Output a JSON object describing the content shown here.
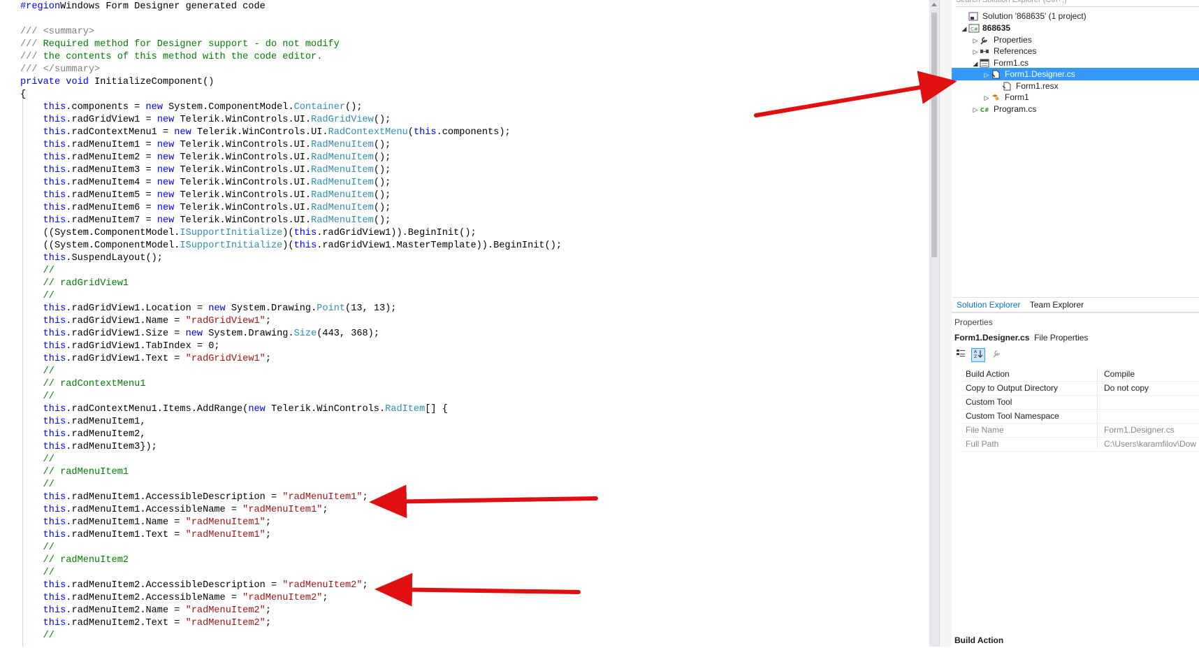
{
  "code_lines": [
    [
      [
        "kw",
        "#region"
      ],
      [
        "",
        "Windows Form Designer generated code"
      ]
    ],
    [],
    [
      [
        "doc",
        "/// <summary>"
      ]
    ],
    [
      [
        "doc",
        "/// "
      ],
      [
        "cm",
        "Required method for Designer support - do not modify"
      ]
    ],
    [
      [
        "doc",
        "/// "
      ],
      [
        "cm",
        "the contents of this method with the code editor."
      ]
    ],
    [
      [
        "doc",
        "/// </summary>"
      ]
    ],
    [
      [
        "kw",
        "private"
      ],
      [
        "",
        " "
      ],
      [
        "kw",
        "void"
      ],
      [
        "",
        " InitializeComponent()"
      ]
    ],
    [
      [
        "",
        "{"
      ]
    ],
    [
      [
        "",
        "    "
      ],
      [
        "kw",
        "this"
      ],
      [
        "",
        ".components = "
      ],
      [
        "kw",
        "new"
      ],
      [
        "",
        " System.ComponentModel."
      ],
      [
        "ty",
        "Container"
      ],
      [
        "",
        "();"
      ]
    ],
    [
      [
        "",
        "    "
      ],
      [
        "kw",
        "this"
      ],
      [
        "",
        ".radGridView1 = "
      ],
      [
        "kw",
        "new"
      ],
      [
        "",
        " Telerik.WinControls.UI."
      ],
      [
        "ty",
        "RadGridView"
      ],
      [
        "",
        "();"
      ]
    ],
    [
      [
        "",
        "    "
      ],
      [
        "kw",
        "this"
      ],
      [
        "",
        ".radContextMenu1 = "
      ],
      [
        "kw",
        "new"
      ],
      [
        "",
        " Telerik.WinControls.UI."
      ],
      [
        "ty",
        "RadContextMenu"
      ],
      [
        "",
        "("
      ],
      [
        "kw",
        "this"
      ],
      [
        "",
        ".components);"
      ]
    ],
    [
      [
        "",
        "    "
      ],
      [
        "kw",
        "this"
      ],
      [
        "",
        ".radMenuItem1 = "
      ],
      [
        "kw",
        "new"
      ],
      [
        "",
        " Telerik.WinControls.UI."
      ],
      [
        "ty",
        "RadMenuItem"
      ],
      [
        "",
        "();"
      ]
    ],
    [
      [
        "",
        "    "
      ],
      [
        "kw",
        "this"
      ],
      [
        "",
        ".radMenuItem2 = "
      ],
      [
        "kw",
        "new"
      ],
      [
        "",
        " Telerik.WinControls.UI."
      ],
      [
        "ty",
        "RadMenuItem"
      ],
      [
        "",
        "();"
      ]
    ],
    [
      [
        "",
        "    "
      ],
      [
        "kw",
        "this"
      ],
      [
        "",
        ".radMenuItem3 = "
      ],
      [
        "kw",
        "new"
      ],
      [
        "",
        " Telerik.WinControls.UI."
      ],
      [
        "ty",
        "RadMenuItem"
      ],
      [
        "",
        "();"
      ]
    ],
    [
      [
        "",
        "    "
      ],
      [
        "kw",
        "this"
      ],
      [
        "",
        ".radMenuItem4 = "
      ],
      [
        "kw",
        "new"
      ],
      [
        "",
        " Telerik.WinControls.UI."
      ],
      [
        "ty",
        "RadMenuItem"
      ],
      [
        "",
        "();"
      ]
    ],
    [
      [
        "",
        "    "
      ],
      [
        "kw",
        "this"
      ],
      [
        "",
        ".radMenuItem5 = "
      ],
      [
        "kw",
        "new"
      ],
      [
        "",
        " Telerik.WinControls.UI."
      ],
      [
        "ty",
        "RadMenuItem"
      ],
      [
        "",
        "();"
      ]
    ],
    [
      [
        "",
        "    "
      ],
      [
        "kw",
        "this"
      ],
      [
        "",
        ".radMenuItem6 = "
      ],
      [
        "kw",
        "new"
      ],
      [
        "",
        " Telerik.WinControls.UI."
      ],
      [
        "ty",
        "RadMenuItem"
      ],
      [
        "",
        "();"
      ]
    ],
    [
      [
        "",
        "    "
      ],
      [
        "kw",
        "this"
      ],
      [
        "",
        ".radMenuItem7 = "
      ],
      [
        "kw",
        "new"
      ],
      [
        "",
        " Telerik.WinControls.UI."
      ],
      [
        "ty",
        "RadMenuItem"
      ],
      [
        "",
        "();"
      ]
    ],
    [
      [
        "",
        "    ((System.ComponentModel."
      ],
      [
        "ty",
        "ISupportInitialize"
      ],
      [
        "",
        ")("
      ],
      [
        "kw",
        "this"
      ],
      [
        "",
        ".radGridView1)).BeginInit();"
      ]
    ],
    [
      [
        "",
        "    ((System.ComponentModel."
      ],
      [
        "ty",
        "ISupportInitialize"
      ],
      [
        "",
        ")("
      ],
      [
        "kw",
        "this"
      ],
      [
        "",
        ".radGridView1.MasterTemplate)).BeginInit();"
      ]
    ],
    [
      [
        "",
        "    "
      ],
      [
        "kw",
        "this"
      ],
      [
        "",
        ".SuspendLayout();"
      ]
    ],
    [
      [
        "",
        "    "
      ],
      [
        "cm",
        "//"
      ]
    ],
    [
      [
        "",
        "    "
      ],
      [
        "cm",
        "// radGridView1"
      ]
    ],
    [
      [
        "",
        "    "
      ],
      [
        "cm",
        "//"
      ]
    ],
    [
      [
        "",
        "    "
      ],
      [
        "kw",
        "this"
      ],
      [
        "",
        ".radGridView1.Location = "
      ],
      [
        "kw",
        "new"
      ],
      [
        "",
        " System.Drawing."
      ],
      [
        "ty",
        "Point"
      ],
      [
        "",
        "(13, 13);"
      ]
    ],
    [
      [
        "",
        "    "
      ],
      [
        "kw",
        "this"
      ],
      [
        "",
        ".radGridView1.Name = "
      ],
      [
        "str",
        "\"radGridView1\""
      ],
      [
        "",
        ";"
      ]
    ],
    [
      [
        "",
        "    "
      ],
      [
        "kw",
        "this"
      ],
      [
        "",
        ".radGridView1.Size = "
      ],
      [
        "kw",
        "new"
      ],
      [
        "",
        " System.Drawing."
      ],
      [
        "ty",
        "Size"
      ],
      [
        "",
        "(443, 368);"
      ]
    ],
    [
      [
        "",
        "    "
      ],
      [
        "kw",
        "this"
      ],
      [
        "",
        ".radGridView1.TabIndex = 0;"
      ]
    ],
    [
      [
        "",
        "    "
      ],
      [
        "kw",
        "this"
      ],
      [
        "",
        ".radGridView1.Text = "
      ],
      [
        "str",
        "\"radGridView1\""
      ],
      [
        "",
        ";"
      ]
    ],
    [
      [
        "",
        "    "
      ],
      [
        "cm",
        "//"
      ]
    ],
    [
      [
        "",
        "    "
      ],
      [
        "cm",
        "// radContextMenu1"
      ]
    ],
    [
      [
        "",
        "    "
      ],
      [
        "cm",
        "//"
      ]
    ],
    [
      [
        "",
        "    "
      ],
      [
        "kw",
        "this"
      ],
      [
        "",
        ".radContextMenu1.Items.AddRange("
      ],
      [
        "kw",
        "new"
      ],
      [
        "",
        " Telerik.WinControls."
      ],
      [
        "ty",
        "RadItem"
      ],
      [
        "",
        "[] {"
      ]
    ],
    [
      [
        "",
        "    "
      ],
      [
        "kw",
        "this"
      ],
      [
        "",
        ".radMenuItem1,"
      ]
    ],
    [
      [
        "",
        "    "
      ],
      [
        "kw",
        "this"
      ],
      [
        "",
        ".radMenuItem2,"
      ]
    ],
    [
      [
        "",
        "    "
      ],
      [
        "kw",
        "this"
      ],
      [
        "",
        ".radMenuItem3});"
      ]
    ],
    [
      [
        "",
        "    "
      ],
      [
        "cm",
        "//"
      ]
    ],
    [
      [
        "",
        "    "
      ],
      [
        "cm",
        "// radMenuItem1"
      ]
    ],
    [
      [
        "",
        "    "
      ],
      [
        "cm",
        "//"
      ]
    ],
    [
      [
        "",
        "    "
      ],
      [
        "kw",
        "this"
      ],
      [
        "",
        ".radMenuItem1.AccessibleDescription = "
      ],
      [
        "str",
        "\"radMenuItem1\""
      ],
      [
        "",
        ";"
      ]
    ],
    [
      [
        "",
        "    "
      ],
      [
        "kw",
        "this"
      ],
      [
        "",
        ".radMenuItem1.AccessibleName = "
      ],
      [
        "str",
        "\"radMenuItem1\""
      ],
      [
        "",
        ";"
      ]
    ],
    [
      [
        "",
        "    "
      ],
      [
        "kw",
        "this"
      ],
      [
        "",
        ".radMenuItem1.Name = "
      ],
      [
        "str",
        "\"radMenuItem1\""
      ],
      [
        "",
        ";"
      ]
    ],
    [
      [
        "",
        "    "
      ],
      [
        "kw",
        "this"
      ],
      [
        "",
        ".radMenuItem1.Text = "
      ],
      [
        "str",
        "\"radMenuItem1\""
      ],
      [
        "",
        ";"
      ]
    ],
    [
      [
        "",
        "    "
      ],
      [
        "cm",
        "//"
      ]
    ],
    [
      [
        "",
        "    "
      ],
      [
        "cm",
        "// radMenuItem2"
      ]
    ],
    [
      [
        "",
        "    "
      ],
      [
        "cm",
        "//"
      ]
    ],
    [
      [
        "",
        "    "
      ],
      [
        "kw",
        "this"
      ],
      [
        "",
        ".radMenuItem2.AccessibleDescription = "
      ],
      [
        "str",
        "\"radMenuItem2\""
      ],
      [
        "",
        ";"
      ]
    ],
    [
      [
        "",
        "    "
      ],
      [
        "kw",
        "this"
      ],
      [
        "",
        ".radMenuItem2.AccessibleName = "
      ],
      [
        "str",
        "\"radMenuItem2\""
      ],
      [
        "",
        ";"
      ]
    ],
    [
      [
        "",
        "    "
      ],
      [
        "kw",
        "this"
      ],
      [
        "",
        ".radMenuItem2.Name = "
      ],
      [
        "str",
        "\"radMenuItem2\""
      ],
      [
        "",
        ";"
      ]
    ],
    [
      [
        "",
        "    "
      ],
      [
        "kw",
        "this"
      ],
      [
        "",
        ".radMenuItem2.Text = "
      ],
      [
        "str",
        "\"radMenuItem2\""
      ],
      [
        "",
        ";"
      ]
    ],
    [
      [
        "",
        "    "
      ],
      [
        "cm",
        "//"
      ]
    ]
  ],
  "solution_explorer": {
    "search_placeholder": "Search Solution Explorer (Ctrl+;)",
    "nodes": [
      {
        "label": "Solution '868635' (1 project)",
        "icon": "solution-icon",
        "expander": ""
      },
      {
        "label": "868635",
        "icon": "csharp-project-icon",
        "expander": "◢",
        "bold": true
      },
      {
        "label": "Properties",
        "icon": "wrench-icon",
        "expander": "▷"
      },
      {
        "label": "References",
        "icon": "references-icon",
        "expander": "▷"
      },
      {
        "label": "Form1.cs",
        "icon": "form-icon",
        "expander": "◢"
      },
      {
        "label": "Form1.Designer.cs",
        "icon": "cs-file-icon",
        "expander": "▷",
        "selected": true
      },
      {
        "label": "Form1.resx",
        "icon": "resx-file-icon",
        "expander": ""
      },
      {
        "label": "Form1",
        "icon": "class-icon",
        "expander": "▷"
      },
      {
        "label": "Program.cs",
        "icon": "csharp-file-icon",
        "expander": "▷"
      }
    ],
    "tabs": [
      "Solution Explorer",
      "Team Explorer"
    ]
  },
  "properties": {
    "title": "Properties",
    "object_name": "Form1.Designer.cs",
    "object_type": "File Properties",
    "rows": [
      {
        "name": "Build Action",
        "value": "Compile",
        "dim": false
      },
      {
        "name": "Copy to Output Directory",
        "value": "Do not copy",
        "dim": false
      },
      {
        "name": "Custom Tool",
        "value": "",
        "dim": false
      },
      {
        "name": "Custom Tool Namespace",
        "value": "",
        "dim": false
      },
      {
        "name": "File Name",
        "value": "Form1.Designer.cs",
        "dim": true
      },
      {
        "name": "Full Path",
        "value": "C:\\Users\\karamfilov\\Dow",
        "dim": true
      }
    ],
    "description_title": "Build Action"
  },
  "colors": {
    "keyword": "#0000ff",
    "type": "#2b91af",
    "string": "#a31515",
    "comment": "#008000",
    "selection": "#3399ff",
    "arrow": "#e01010"
  }
}
